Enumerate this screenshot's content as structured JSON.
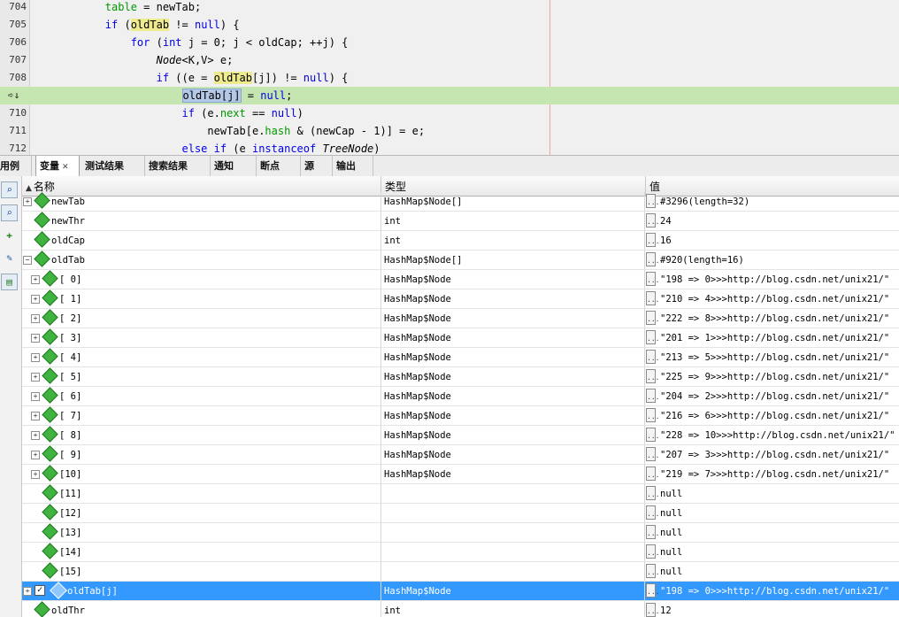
{
  "editor": {
    "lines": [
      {
        "num": "704",
        "html": "        <span class='fld'>table</span> = newTab;"
      },
      {
        "num": "705",
        "html": "        <span class='kw'>if</span> (<span class='hl'>oldTab</span> != <span class='kw'>null</span>) {"
      },
      {
        "num": "706",
        "html": "            <span class='kw'>for</span> (<span class='kw'>int</span> j = 0; j &lt; oldCap; ++j) {"
      },
      {
        "num": "707",
        "html": "                <span class='it'>Node</span>&lt;K,V&gt; e;"
      },
      {
        "num": "708",
        "html": "                <span class='kw'>if</span> ((e = <span class='hl'>oldTab</span>[j]) != <span class='kw'>null</span>) {"
      },
      {
        "num": "",
        "html": "                    <span class='hlsel'>oldTab[j]</span> = <span class='kw'>null</span>;",
        "current": true
      },
      {
        "num": "710",
        "html": "                    <span class='kw'>if</span> (e.<span class='fld'>next</span> == <span class='kw'>null</span>)"
      },
      {
        "num": "711",
        "html": "                        newTab[e.<span class='fld'>hash</span> &amp; (newCap - 1)] = e;"
      },
      {
        "num": "712",
        "html": "                    <span class='kw'>else if</span> (e <span class='kw'>instanceof</span> <span class='it'>TreeNode</span>)"
      }
    ]
  },
  "tabs": [
    {
      "label": "用例"
    },
    {
      "label": "变量",
      "active": true
    },
    {
      "label": "测试结果"
    },
    {
      "label": "搜索结果"
    },
    {
      "label": "通知"
    },
    {
      "label": "断点"
    },
    {
      "label": "源"
    },
    {
      "label": "输出"
    }
  ],
  "columns": {
    "name": "名称",
    "type": "类型",
    "value": "值"
  },
  "rows": [
    {
      "name": "newTab",
      "type": "HashMap$Node[]",
      "value": "#3296(length=32)",
      "indent": 0,
      "expander": "+",
      "icon": "var"
    },
    {
      "name": "newThr",
      "type": "int",
      "value": "24",
      "indent": 0,
      "expander": "",
      "icon": "var"
    },
    {
      "name": "oldCap",
      "type": "int",
      "value": "16",
      "indent": 0,
      "expander": "",
      "icon": "var"
    },
    {
      "name": "oldTab",
      "type": "HashMap$Node[]",
      "value": "#920(length=16)",
      "indent": 0,
      "expander": "−",
      "icon": "var"
    },
    {
      "name": "[ 0]",
      "type": "HashMap$Node",
      "value": "\"198 => 0>>>http://blog.csdn.net/unix21/\"",
      "indent": 1,
      "expander": "+",
      "icon": "var"
    },
    {
      "name": "[ 1]",
      "type": "HashMap$Node",
      "value": "\"210 => 4>>>http://blog.csdn.net/unix21/\"",
      "indent": 1,
      "expander": "+",
      "icon": "var"
    },
    {
      "name": "[ 2]",
      "type": "HashMap$Node",
      "value": "\"222 => 8>>>http://blog.csdn.net/unix21/\"",
      "indent": 1,
      "expander": "+",
      "icon": "var"
    },
    {
      "name": "[ 3]",
      "type": "HashMap$Node",
      "value": "\"201 => 1>>>http://blog.csdn.net/unix21/\"",
      "indent": 1,
      "expander": "+",
      "icon": "var"
    },
    {
      "name": "[ 4]",
      "type": "HashMap$Node",
      "value": "\"213 => 5>>>http://blog.csdn.net/unix21/\"",
      "indent": 1,
      "expander": "+",
      "icon": "var"
    },
    {
      "name": "[ 5]",
      "type": "HashMap$Node",
      "value": "\"225 => 9>>>http://blog.csdn.net/unix21/\"",
      "indent": 1,
      "expander": "+",
      "icon": "var"
    },
    {
      "name": "[ 6]",
      "type": "HashMap$Node",
      "value": "\"204 => 2>>>http://blog.csdn.net/unix21/\"",
      "indent": 1,
      "expander": "+",
      "icon": "var"
    },
    {
      "name": "[ 7]",
      "type": "HashMap$Node",
      "value": "\"216 => 6>>>http://blog.csdn.net/unix21/\"",
      "indent": 1,
      "expander": "+",
      "icon": "var"
    },
    {
      "name": "[ 8]",
      "type": "HashMap$Node",
      "value": "\"228 => 10>>>http://blog.csdn.net/unix21/\"",
      "indent": 1,
      "expander": "+",
      "icon": "var"
    },
    {
      "name": "[ 9]",
      "type": "HashMap$Node",
      "value": "\"207 => 3>>>http://blog.csdn.net/unix21/\"",
      "indent": 1,
      "expander": "+",
      "icon": "var"
    },
    {
      "name": "[10]",
      "type": "HashMap$Node",
      "value": "\"219 => 7>>>http://blog.csdn.net/unix21/\"",
      "indent": 1,
      "expander": "+",
      "icon": "var"
    },
    {
      "name": "[11]",
      "type": "",
      "value": "null",
      "indent": 1,
      "expander": "",
      "icon": "var"
    },
    {
      "name": "[12]",
      "type": "",
      "value": "null",
      "indent": 1,
      "expander": "",
      "icon": "var"
    },
    {
      "name": "[13]",
      "type": "",
      "value": "null",
      "indent": 1,
      "expander": "",
      "icon": "var"
    },
    {
      "name": "[14]",
      "type": "",
      "value": "null",
      "indent": 1,
      "expander": "",
      "icon": "var"
    },
    {
      "name": "[15]",
      "type": "",
      "value": "null",
      "indent": 1,
      "expander": "",
      "icon": "var"
    },
    {
      "name": "oldTab[j]",
      "type": "HashMap$Node",
      "value": "\"198 => 0>>>http://blog.csdn.net/unix21/\"",
      "indent": 0,
      "expander": "+",
      "icon": "watch",
      "selected": true,
      "checked": true
    },
    {
      "name": "oldThr",
      "type": "int",
      "value": "12",
      "indent": 0,
      "expander": "",
      "icon": "var"
    }
  ]
}
